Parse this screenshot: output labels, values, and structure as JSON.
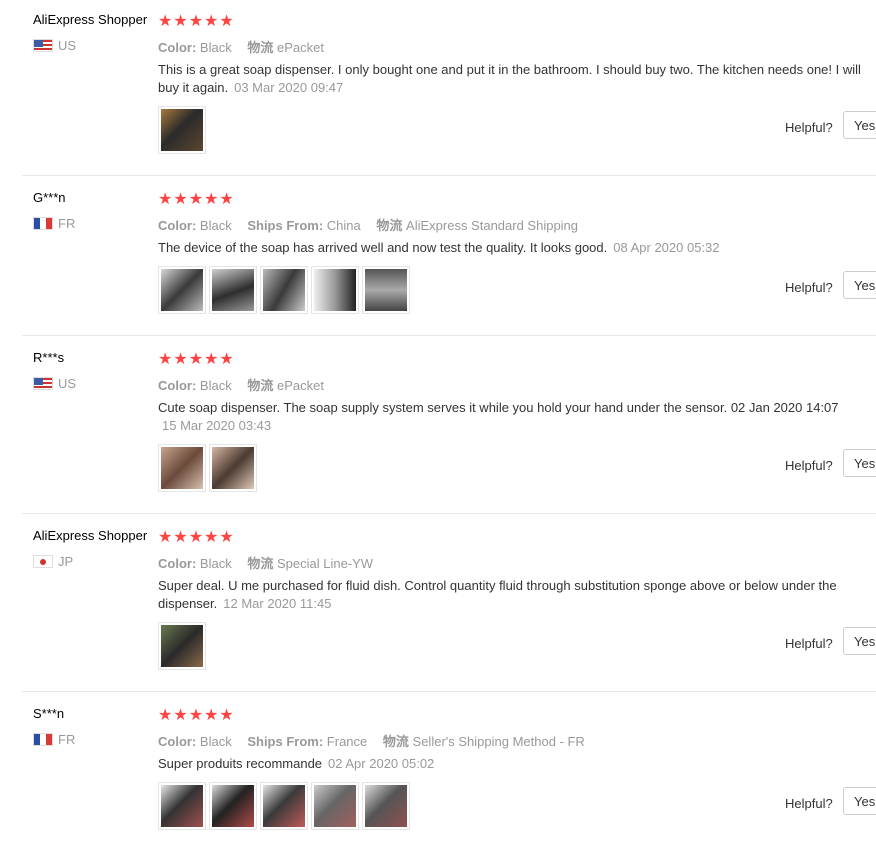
{
  "reviews": [
    {
      "user": "AliExpress Shopper",
      "country": "US",
      "color_label": "Color:",
      "color_value": "Black",
      "ships_label": "",
      "ships_value": "",
      "logistics_label": "物流",
      "logistics_value": "ePacket",
      "text": "This is a great soap dispenser. I only bought one and put it in the bathroom. I should buy two. The kitchen needs one! I will buy it again.",
      "date": "03 Mar 2020 09:47",
      "helpful": "Helpful?",
      "yes": "Yes"
    },
    {
      "user": "G***n",
      "country": "FR",
      "color_label": "Color:",
      "color_value": "Black",
      "ships_label": "Ships From:",
      "ships_value": "China",
      "logistics_label": "物流",
      "logistics_value": "AliExpress Standard Shipping",
      "text": "The device of the soap has arrived well and now test the quality. It looks good.",
      "date": "08 Apr 2020 05:32",
      "helpful": "Helpful?",
      "yes": "Yes"
    },
    {
      "user": "R***s",
      "country": "US",
      "color_label": "Color:",
      "color_value": "Black",
      "ships_label": "",
      "ships_value": "",
      "logistics_label": "物流",
      "logistics_value": "ePacket",
      "text": "Cute soap dispenser. The soap supply system serves it while you hold your hand under the sensor. 02 Jan 2020 14:07",
      "date": "15 Mar 2020 03:43",
      "helpful": "Helpful?",
      "yes": "Yes"
    },
    {
      "user": "AliExpress Shopper",
      "country": "JP",
      "color_label": "Color:",
      "color_value": "Black",
      "ships_label": "",
      "ships_value": "",
      "logistics_label": "物流",
      "logistics_value": "Special Line-YW",
      "text": "Super deal. U me purchased for fluid dish. Control quantity fluid through substitution sponge above or below under the dispenser.",
      "date": "12 Mar 2020 11:45",
      "helpful": "Helpful?",
      "yes": "Yes"
    },
    {
      "user": "S***n",
      "country": "FR",
      "color_label": "Color:",
      "color_value": "Black",
      "ships_label": "Ships From:",
      "ships_value": "France",
      "logistics_label": "物流",
      "logistics_value": "Seller's Shipping Method - FR",
      "text": "Super produits recommande",
      "date": "02 Apr 2020 05:02",
      "helpful": "Helpful?",
      "yes": "Yes"
    }
  ],
  "stars": "★★★★★",
  "rating": 5,
  "colors": {
    "star": "#ff4747",
    "muted": "#999999",
    "text": "#333333"
  }
}
